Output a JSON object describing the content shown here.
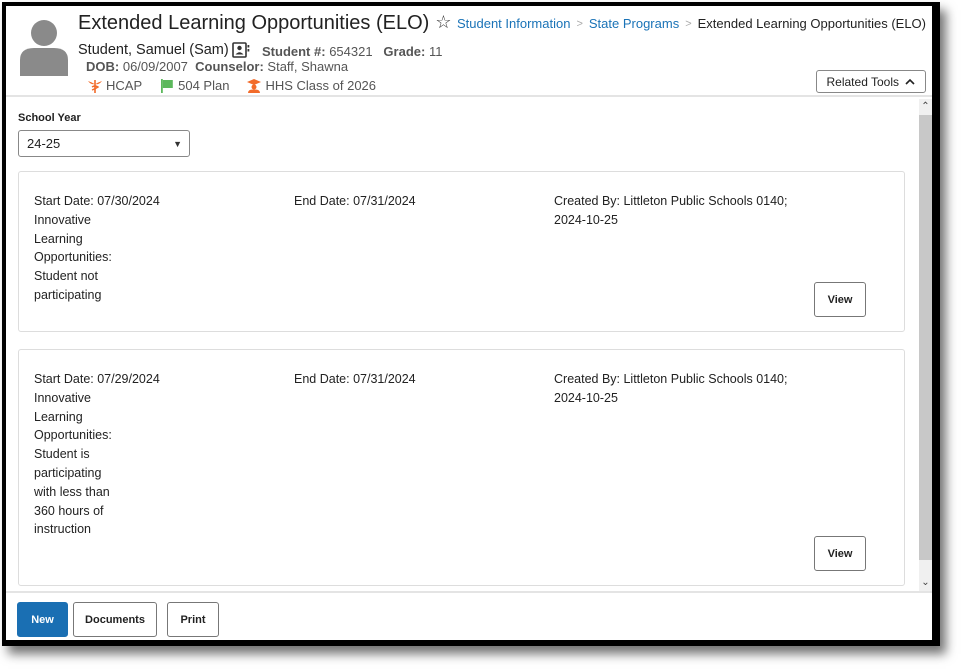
{
  "header": {
    "title": "Extended Learning Opportunities (ELO)",
    "student_name": "Student, Samuel (Sam)",
    "student_number_label": "Student #:",
    "student_number": "654321",
    "grade_label": "Grade:",
    "grade": "11",
    "dob_label": "DOB:",
    "dob": "06/09/2007",
    "counselor_label": "Counselor:",
    "counselor": "Staff, Shawna",
    "flags": [
      {
        "label": "HCAP",
        "icon": "caduceus-icon",
        "color": "#f26b2a"
      },
      {
        "label": "504 Plan",
        "icon": "flag-icon",
        "color": "#5cb85c"
      },
      {
        "label": "HHS Class of 2026",
        "icon": "graduation-icon",
        "color": "#f26b2a"
      }
    ]
  },
  "breadcrumb": {
    "items": [
      "Student Information",
      "State Programs"
    ],
    "current": "Extended Learning Opportunities (ELO)"
  },
  "related_tools": {
    "label": "Related Tools"
  },
  "school_year": {
    "label": "School Year",
    "value": "24-25"
  },
  "records": [
    {
      "start": "Start Date: 07/30/2024",
      "description": "Innovative Learning Opportunities: Student not participating",
      "end": "End Date: 07/31/2024",
      "created": "Created By: Littleton Public Schools 0140; 2024-10-25",
      "view_label": "View"
    },
    {
      "start": "Start Date: 07/29/2024",
      "description": "Innovative Learning Opportunities: Student is participating with less than 360 hours of instruction",
      "end": "End Date: 07/31/2024",
      "created": "Created By: Littleton Public Schools 0140; 2024-10-25",
      "view_label": "View"
    }
  ],
  "footer": {
    "new_label": "New",
    "documents_label": "Documents",
    "print_label": "Print"
  },
  "colors": {
    "accent": "#1a6fb3",
    "link": "#1a73b7"
  }
}
